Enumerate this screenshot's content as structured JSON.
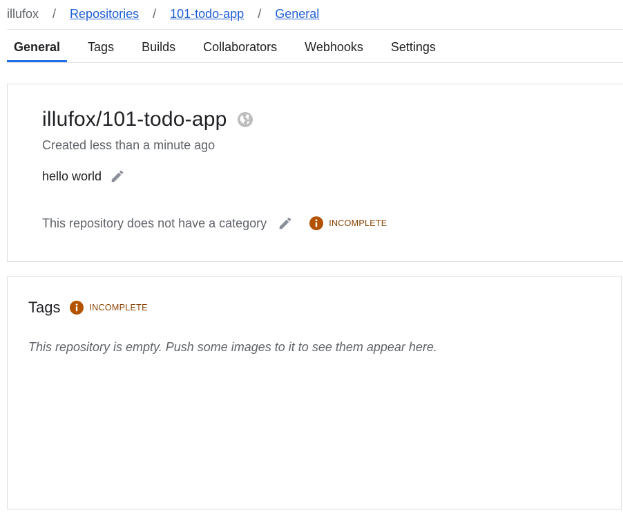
{
  "breadcrumb": {
    "owner": "illufox",
    "separator": "/",
    "repositories": "Repositories",
    "repo": "101-todo-app",
    "current": "General"
  },
  "tabs": [
    {
      "label": "General",
      "active": true
    },
    {
      "label": "Tags",
      "active": false
    },
    {
      "label": "Builds",
      "active": false
    },
    {
      "label": "Collaborators",
      "active": false
    },
    {
      "label": "Webhooks",
      "active": false
    },
    {
      "label": "Settings",
      "active": false
    }
  ],
  "general": {
    "repo_name": "illufox/101-todo-app",
    "visibility_icon": "globe-icon",
    "created": "Created less than a minute ago",
    "description": "hello world",
    "category_text": "This repository does not have a category",
    "category_status": "INCOMPLETE"
  },
  "tags": {
    "title": "Tags",
    "status": "INCOMPLETE",
    "empty_message": "This repository is empty. Push some images to it to see them appear here."
  },
  "colors": {
    "link": "#1f5ed6",
    "tab_indicator": "#1f6feb",
    "warning": "#b35300",
    "warning_text": "#8a4100"
  }
}
